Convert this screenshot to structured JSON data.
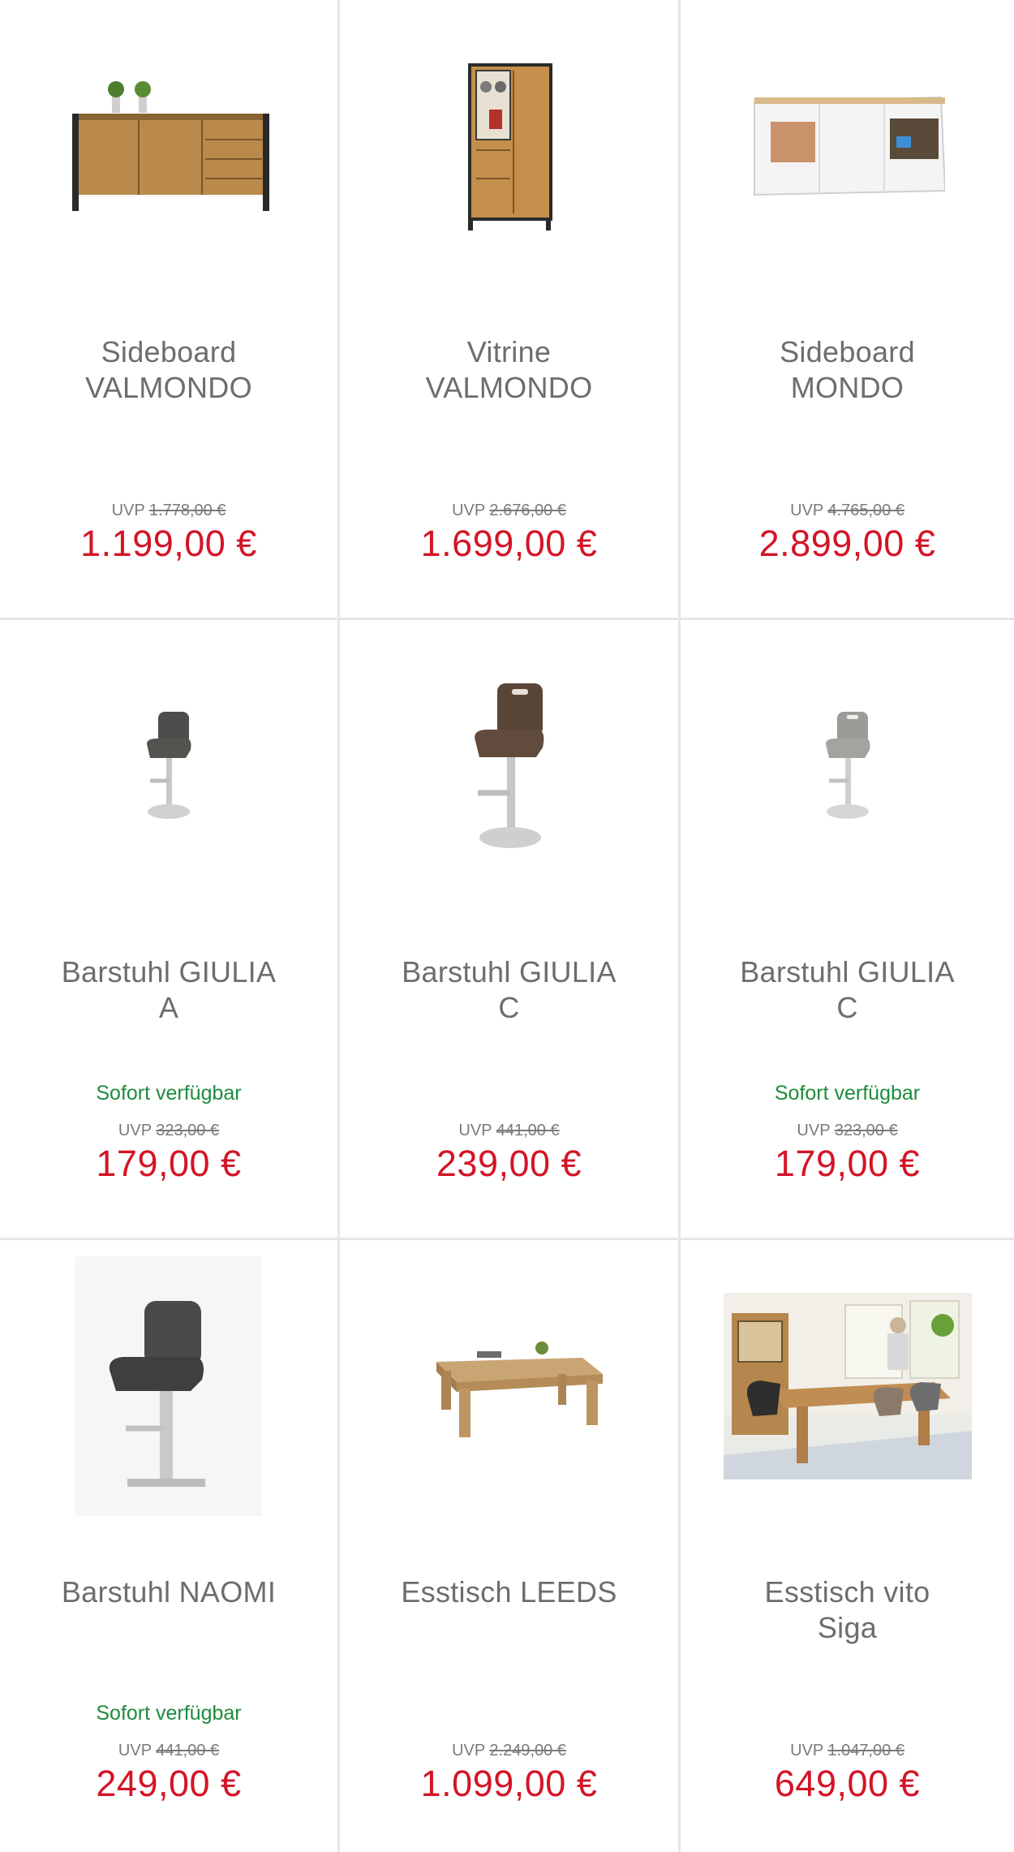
{
  "products": [
    {
      "title_line1": "Sideboard",
      "title_line2": "VALMONDO",
      "availability": "",
      "uvp_label": "UVP",
      "uvp_price": "1.778,00 €",
      "price": "1.199,00 €",
      "image": "sideboard-valmondo"
    },
    {
      "title_line1": "Vitrine",
      "title_line2": "VALMONDO",
      "availability": "",
      "uvp_label": "UVP",
      "uvp_price": "2.676,00 €",
      "price": "1.699,00 €",
      "image": "vitrine-valmondo"
    },
    {
      "title_line1": "Sideboard",
      "title_line2": "MONDO",
      "availability": "",
      "uvp_label": "UVP",
      "uvp_price": "4.765,00 €",
      "price": "2.899,00 €",
      "image": "sideboard-mondo"
    },
    {
      "title_line1": "Barstuhl GIULIA",
      "title_line2": "A",
      "availability": "Sofort verfügbar",
      "uvp_label": "UVP",
      "uvp_price": "323,00 €",
      "price": "179,00 €",
      "image": "barstool-dark"
    },
    {
      "title_line1": "Barstuhl GIULIA",
      "title_line2": "C",
      "availability": "",
      "uvp_label": "UVP",
      "uvp_price": "441,00 €",
      "price": "239,00 €",
      "image": "barstool-brown"
    },
    {
      "title_line1": "Barstuhl GIULIA",
      "title_line2": "C",
      "availability": "Sofort verfügbar",
      "uvp_label": "UVP",
      "uvp_price": "323,00 €",
      "price": "179,00 €",
      "image": "barstool-grey"
    },
    {
      "title_line1": "Barstuhl NAOMI",
      "title_line2": "",
      "availability": "Sofort verfügbar",
      "uvp_label": "UVP",
      "uvp_price": "441,00 €",
      "price": "249,00 €",
      "image": "barstool-naomi"
    },
    {
      "title_line1": "Esstisch LEEDS",
      "title_line2": "",
      "availability": "",
      "uvp_label": "UVP",
      "uvp_price": "2.249,00 €",
      "price": "1.099,00 €",
      "image": "dining-table-leeds"
    },
    {
      "title_line1": "Esstisch vito",
      "title_line2": "Siga",
      "availability": "",
      "uvp_label": "UVP",
      "uvp_price": "1.047,00 €",
      "price": "649,00 €",
      "image": "dining-room-photo"
    }
  ],
  "colors": {
    "price": "#d41426",
    "availability": "#1e8c3c",
    "title": "#6d6d6d",
    "divider": "#e6e6e6"
  }
}
